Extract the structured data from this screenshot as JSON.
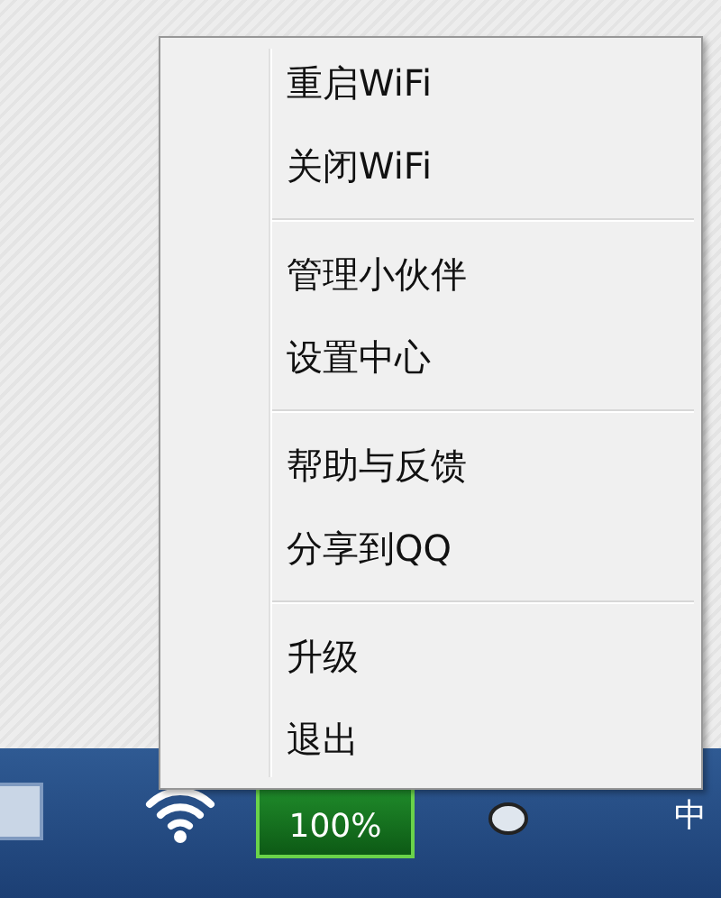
{
  "context_menu": {
    "sections": [
      {
        "items": [
          {
            "label": "重启WiFi"
          },
          {
            "label": "关闭WiFi"
          }
        ]
      },
      {
        "items": [
          {
            "label": "管理小伙伴"
          },
          {
            "label": "设置中心"
          }
        ]
      },
      {
        "items": [
          {
            "label": "帮助与反馈"
          },
          {
            "label": "分享到QQ"
          }
        ]
      },
      {
        "items": [
          {
            "label": "升级"
          },
          {
            "label": "退出"
          }
        ]
      }
    ]
  },
  "taskbar": {
    "battery_badge": "100%",
    "input_method": "中"
  }
}
